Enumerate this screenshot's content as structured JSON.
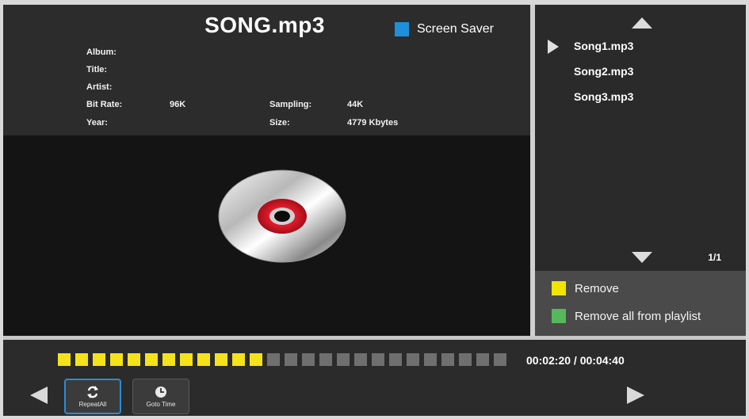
{
  "header": {
    "song_title": "SONG.mp3",
    "screen_saver_label": "Screen Saver",
    "screen_saver_color": "#1e8fdb"
  },
  "meta": {
    "album_label": "Album:",
    "title_label": "Title:",
    "artist_label": "Artist:",
    "bitrate_label": "Bit Rate:",
    "bitrate_value": "96K",
    "year_label": "Year:",
    "sampling_label": "Sampling:",
    "sampling_value": "44K",
    "size_label": "Size:",
    "size_value": "4779 Kbytes"
  },
  "playlist": {
    "items": [
      {
        "label": "Song1.mp3",
        "selected": true
      },
      {
        "label": "Song2.mp3",
        "selected": false
      },
      {
        "label": "Song3.mp3",
        "selected": false
      }
    ],
    "page": "1/1"
  },
  "options": [
    {
      "label": "Remove",
      "color": "#f0e400"
    },
    {
      "label": "Remove all from playlist",
      "color": "#55b85a"
    }
  ],
  "playback": {
    "progress_total_segments": 26,
    "progress_filled_segments": 12,
    "filled_color": "#f4e21a",
    "empty_color": "#6f6f6f",
    "time": "00:02:20 / 00:04:40"
  },
  "controls": {
    "repeat_label": "RepeatAll",
    "goto_label": "Goto Time"
  }
}
